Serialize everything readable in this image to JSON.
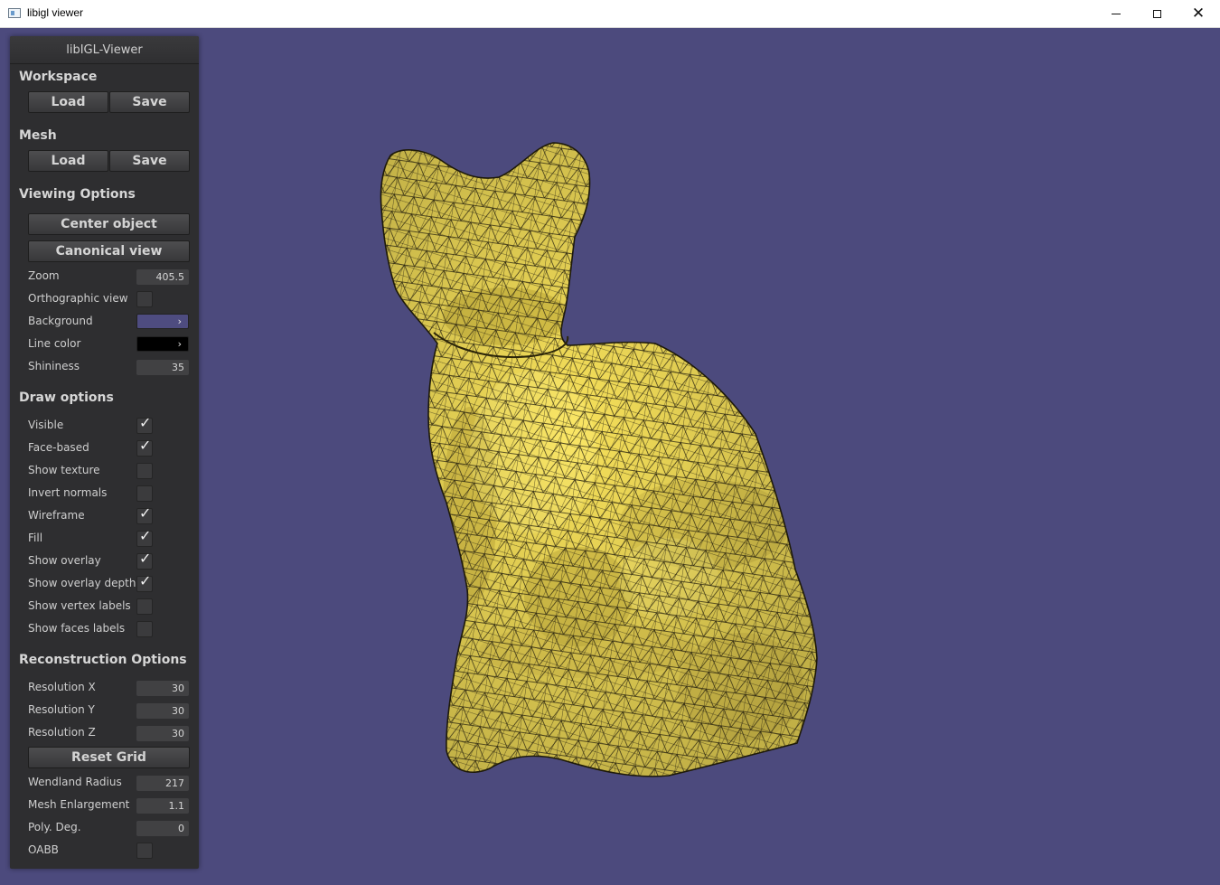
{
  "window": {
    "title": "libigl viewer"
  },
  "panel": {
    "title": "libIGL-Viewer",
    "workspace": {
      "heading": "Workspace",
      "load": "Load",
      "save": "Save"
    },
    "mesh": {
      "heading": "Mesh",
      "load": "Load",
      "save": "Save"
    },
    "viewing": {
      "heading": "Viewing Options",
      "center": "Center object",
      "canonical": "Canonical view",
      "zoom_label": "Zoom",
      "zoom_value": "405.5",
      "ortho_label": "Orthographic view",
      "ortho_checked": false,
      "background_label": "Background",
      "background_color": "#4e4c80",
      "linecolor_label": "Line color",
      "line_color": "#000000",
      "shininess_label": "Shininess",
      "shininess_value": "35"
    },
    "draw": {
      "heading": "Draw options",
      "items": [
        {
          "label": "Visible",
          "checked": true
        },
        {
          "label": "Face-based",
          "checked": true
        },
        {
          "label": "Show texture",
          "checked": false
        },
        {
          "label": "Invert normals",
          "checked": false
        },
        {
          "label": "Wireframe",
          "checked": true
        },
        {
          "label": "Fill",
          "checked": true
        },
        {
          "label": "Show overlay",
          "checked": true
        },
        {
          "label": "Show overlay depth",
          "checked": true
        },
        {
          "label": "Show vertex labels",
          "checked": false
        },
        {
          "label": "Show faces labels",
          "checked": false
        }
      ]
    },
    "recon": {
      "heading": "Reconstruction Options",
      "resx_label": "Resolution X",
      "resx_value": "30",
      "resy_label": "Resolution Y",
      "resy_value": "30",
      "resz_label": "Resolution Z",
      "resz_value": "30",
      "reset": "Reset Grid",
      "wendland_label": "Wendland Radius",
      "wendland_value": "217",
      "enlarge_label": "Mesh Enlargement",
      "enlarge_value": "1.1",
      "poly_label": "Poly. Deg.",
      "poly_value": "0",
      "oabb_label": "OABB",
      "oabb_checked": false
    }
  },
  "scene": {
    "mesh_color": "#f7e15a",
    "edge_color": "#2a2510"
  }
}
